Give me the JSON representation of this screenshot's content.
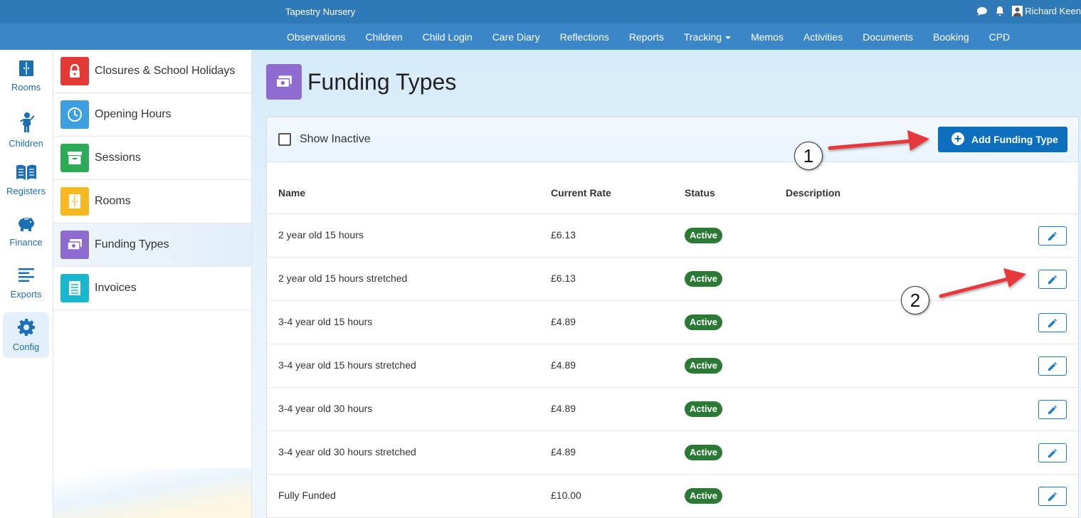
{
  "topbar": {
    "brand": "Tapestry Nursery",
    "user_name": "Richard Keen"
  },
  "nav": {
    "items": [
      "Observations",
      "Children",
      "Child Login",
      "Care Diary",
      "Reflections",
      "Reports",
      "Tracking",
      "Memos",
      "Activities",
      "Documents",
      "Booking",
      "CPD"
    ]
  },
  "rail": {
    "items": [
      {
        "label": "Rooms",
        "icon": "door-icon"
      },
      {
        "label": "Children",
        "icon": "child-icon"
      },
      {
        "label": "Registers",
        "icon": "book-icon"
      },
      {
        "label": "Finance",
        "icon": "piggy-bank-icon"
      },
      {
        "label": "Exports",
        "icon": "lines-icon"
      },
      {
        "label": "Config",
        "icon": "gear-icon"
      }
    ],
    "active": "Config"
  },
  "submenu": {
    "items": [
      {
        "label": "Closures & School Holidays",
        "color": "#e53935",
        "icon": "lock-icon"
      },
      {
        "label": "Opening Hours",
        "color": "#3d9ee0",
        "icon": "clock-icon"
      },
      {
        "label": "Sessions",
        "color": "#2bab55",
        "icon": "archive-icon"
      },
      {
        "label": "Rooms",
        "color": "#f6b81c",
        "icon": "door-icon"
      },
      {
        "label": "Funding Types",
        "color": "#8e6ccf",
        "icon": "money-icon"
      },
      {
        "label": "Invoices",
        "color": "#18b6cf",
        "icon": "receipt-icon"
      }
    ],
    "active": "Funding Types"
  },
  "page": {
    "title": "Funding Types",
    "show_inactive_label": "Show Inactive",
    "add_button_label": "Add Funding Type",
    "columns": {
      "name": "Name",
      "rate": "Current Rate",
      "status": "Status",
      "description": "Description"
    },
    "rows": [
      {
        "name": "2 year old 15 hours",
        "rate": "£6.13",
        "status": "Active"
      },
      {
        "name": "2 year old 15 hours stretched",
        "rate": "£6.13",
        "status": "Active"
      },
      {
        "name": "3-4 year old 15 hours",
        "rate": "£4.89",
        "status": "Active"
      },
      {
        "name": "3-4 year old 15 hours stretched",
        "rate": "£4.89",
        "status": "Active"
      },
      {
        "name": "3-4 year old 30 hours",
        "rate": "£4.89",
        "status": "Active"
      },
      {
        "name": "3-4 year old 30 hours stretched",
        "rate": "£4.89",
        "status": "Active"
      },
      {
        "name": "Fully Funded",
        "rate": "£10.00",
        "status": "Active"
      }
    ]
  },
  "annotations": {
    "step1": "1",
    "step2": "2",
    "arrow_color": "#e8393a"
  }
}
